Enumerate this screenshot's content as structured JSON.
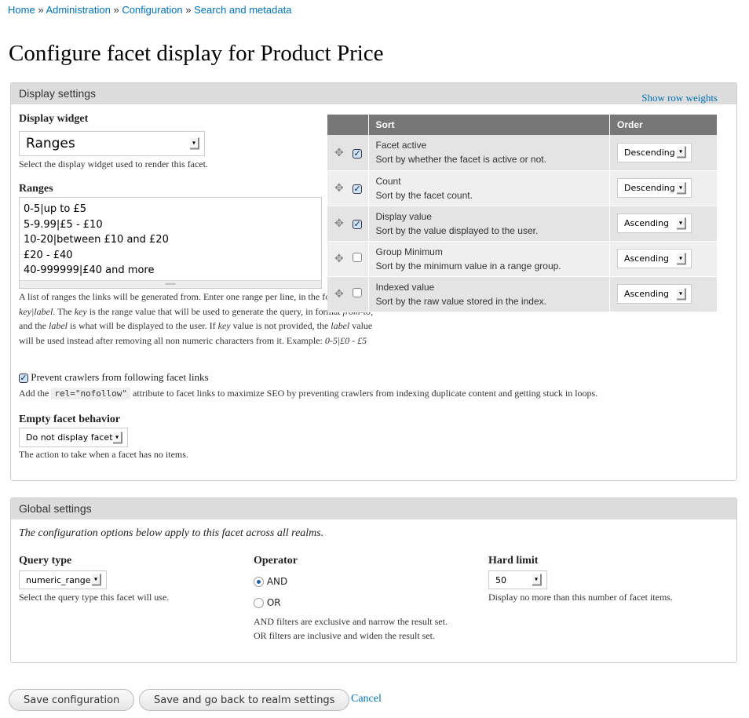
{
  "breadcrumb": {
    "items": [
      "Home",
      "Administration",
      "Configuration",
      "Search and metadata"
    ],
    "sep": "»"
  },
  "page_title": "Configure facet display for Product Price",
  "display_settings": {
    "legend": "Display settings",
    "show_row_weights": "Show row weights",
    "widget_label": "Display widget",
    "widget_value": "Ranges",
    "widget_desc": "Select the display widget used to render this facet.",
    "ranges_label": "Ranges",
    "ranges_lines": [
      "0-5|up to £5",
      "5-9.99|£5 - £10",
      "10-20|between £10 and £20",
      "£20 - £40",
      "40-999999|£40 and more"
    ],
    "ranges_desc": {
      "p1": "A list of ranges the links will be generated from. Enter one range per line, in the format ",
      "e1": "key|label",
      "p2": ". The ",
      "e2": "key",
      "p3": " is the range value that will be used to generate the query, in format ",
      "e3": "from-to",
      "p4": ", and the ",
      "e4": "label",
      "p5": " is what will be displayed to the user. If ",
      "e5": "key",
      "p6": " value is not provided, the ",
      "e6": "label",
      "p7": " value will be used instead after removing all non numeric characters from it. Example: ",
      "e7": "0-5|£0 - £5"
    },
    "sort_table": {
      "headers": [
        "Sort",
        "Order"
      ],
      "rows": [
        {
          "name": "Facet active",
          "desc": "Sort by whether the facet is active or not.",
          "checked": true,
          "order": "Descending"
        },
        {
          "name": "Count",
          "desc": "Sort by the facet count.",
          "checked": true,
          "order": "Descending"
        },
        {
          "name": "Display value",
          "desc": "Sort by the value displayed to the user.",
          "checked": true,
          "order": "Ascending"
        },
        {
          "name": "Group Minimum",
          "desc": "Sort by the minimum value in a range group.",
          "checked": false,
          "order": "Ascending"
        },
        {
          "name": "Indexed value",
          "desc": "Sort by the raw value stored in the index.",
          "checked": false,
          "order": "Ascending"
        }
      ]
    },
    "nofollow_label": "Prevent crawlers from following facet links",
    "nofollow_checked": true,
    "nofollow_desc_pre": "Add the",
    "nofollow_code": "rel=\"nofollow\"",
    "nofollow_desc_post": "attribute to facet links to maximize SEO by preventing crawlers from indexing duplicate content and getting stuck in loops.",
    "empty_label": "Empty facet behavior",
    "empty_value": "Do not display facet",
    "empty_desc": "The action to take when a facet has no items."
  },
  "global_settings": {
    "legend": "Global settings",
    "intro": "The configuration options below apply to this facet across all realms.",
    "query_type_label": "Query type",
    "query_type_value": "numeric_range",
    "query_type_desc": "Select the query type this facet will use.",
    "operator_label": "Operator",
    "operator_options": [
      "AND",
      "OR"
    ],
    "operator_selected": "AND",
    "operator_desc1": "AND filters are exclusive and narrow the result set.",
    "operator_desc2": "OR filters are inclusive and widen the result set.",
    "hard_limit_label": "Hard limit",
    "hard_limit_value": "50",
    "hard_limit_desc": "Display no more than this number of facet items."
  },
  "actions": {
    "save": "Save configuration",
    "save_back": "Save and go back to realm settings",
    "cancel": "Cancel"
  }
}
